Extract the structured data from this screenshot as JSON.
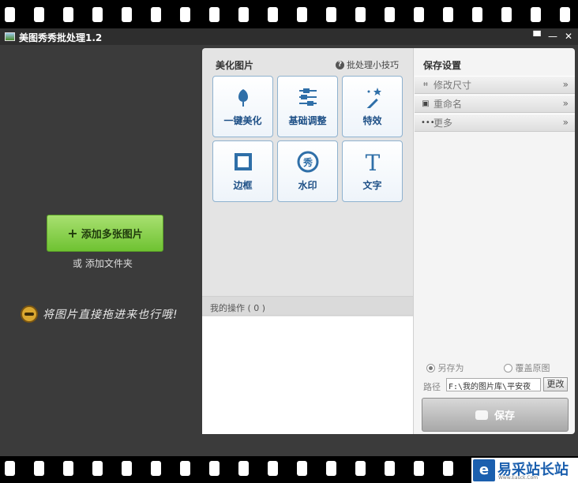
{
  "window": {
    "title": "美图秀秀批处理1.2",
    "controls": [
      "feedback",
      "minimize",
      "close"
    ]
  },
  "left_pane": {
    "add_images_label": "添加多张图片",
    "add_folder_label": "或 添加文件夹",
    "drag_hint": "将图片直接拖进来也行哦!"
  },
  "beautify": {
    "title": "美化图片",
    "tips_label": "批处理小技巧",
    "tiles": [
      {
        "label": "一键美化",
        "icon": "tulip-icon"
      },
      {
        "label": "基础调整",
        "icon": "sliders-icon"
      },
      {
        "label": "特效",
        "icon": "magic-wand-icon"
      },
      {
        "label": "边框",
        "icon": "frame-icon"
      },
      {
        "label": "水印",
        "icon": "watermark-stamp-icon"
      },
      {
        "label": "文字",
        "icon": "text-t-icon"
      }
    ],
    "ops_label": "我的操作 ( 0 )"
  },
  "save_settings": {
    "title": "保存设置",
    "sections": [
      {
        "label": "修改尺寸",
        "icon": "crop-icon"
      },
      {
        "label": "重命名",
        "icon": "rename-icon"
      },
      {
        "label": "更多",
        "icon": "more-dots-icon"
      }
    ],
    "save_as_label": "另存为",
    "overwrite_label": "覆盖原图",
    "selected_option": "另存为",
    "path_label": "路径",
    "path_value": "F:\\我的图片库\\平安夜",
    "change_label": "更改",
    "save_label": "保存"
  },
  "watermark": {
    "text": "易采站长站",
    "sub": "Www.Easck.Com"
  }
}
